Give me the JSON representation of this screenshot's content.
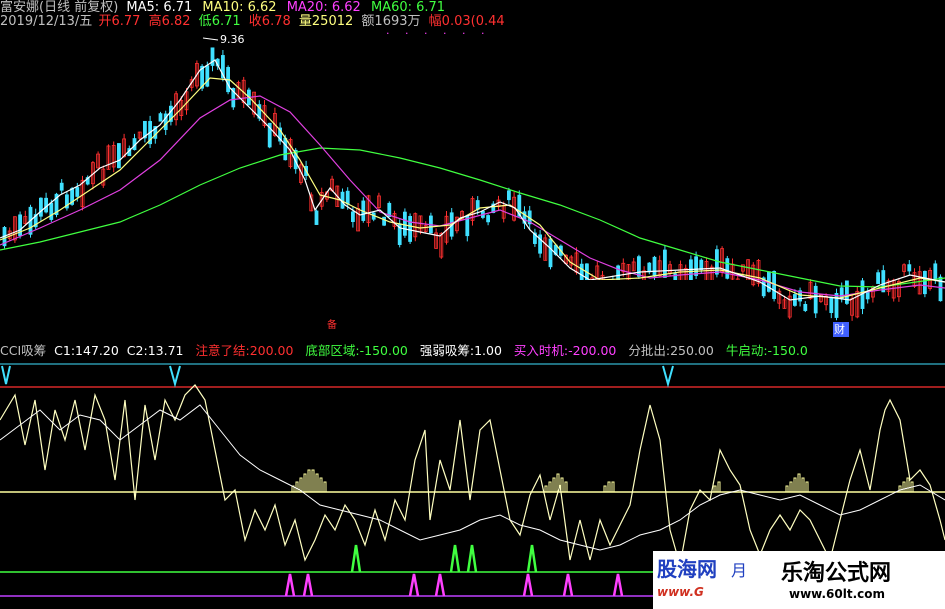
{
  "colors": {
    "background": "#000000",
    "up_candle": "#ff3030",
    "down_candle": "#40e0ff",
    "ma5": "#ffffff",
    "ma10": "#ffff80",
    "ma20": "#ff40ff",
    "ma60": "#40ff40",
    "cci_line": "#ffffa0",
    "white_line": "#ffffff",
    "level_top": "#ff3030",
    "level_mid": "#ffffa0",
    "level_green": "#40ff40",
    "level_magenta": "#c040ff",
    "bar_yellow": "#ffffa0",
    "spike_green": "#40ff40",
    "spike_magenta": "#ff40ff",
    "cyan_marker": "#40e0ff"
  },
  "header": {
    "title": "富安娜(日线 前复权)",
    "ma5_label": "MA5:",
    "ma5_value": "6.71",
    "ma10_label": "MA10:",
    "ma10_value": "6.62",
    "ma20_label": "MA20:",
    "ma20_value": "6.62",
    "ma60_label": "MA60:",
    "ma60_value": "6.71"
  },
  "quote": {
    "date": "2019/12/13/五",
    "open_label": "开",
    "open_value": "6.77",
    "high_label": "高",
    "high_value": "6.82",
    "low_label": "低",
    "low_value": "6.71",
    "close_label": "收",
    "close_value": "6.78",
    "volume_label": "量",
    "volume_value": "25012",
    "amount_label": "额",
    "amount_value": "1693万",
    "change_label": "幅",
    "change_value": "0.03(0.44"
  },
  "price_chart": {
    "peak_marker": "9.36",
    "event_marker_1": "备",
    "event_marker_2": "财"
  },
  "indicator": {
    "name": "CCI吸筹",
    "c1_label": "C1:",
    "c1_value": "147.20",
    "c2_label": "C2:",
    "c2_value": "13.71",
    "attention_label": "注意了结:",
    "attention_value": "200.00",
    "bottom_label": "底部区域:",
    "bottom_value": "-150.00",
    "strong_label": "强弱吸筹:",
    "strong_value": "1.00",
    "buy_label": "买入时机:",
    "buy_value": "-200.00",
    "sell_label": "分批出:",
    "sell_value": "250.00",
    "bull_label": "牛启动:",
    "bull_value": "-150.0"
  },
  "watermarks": {
    "left_brand": "股海网",
    "left_url": "www.G",
    "left_cut": "月",
    "right_brand": "乐淘公式网",
    "right_url": "www.60lt.com"
  }
}
